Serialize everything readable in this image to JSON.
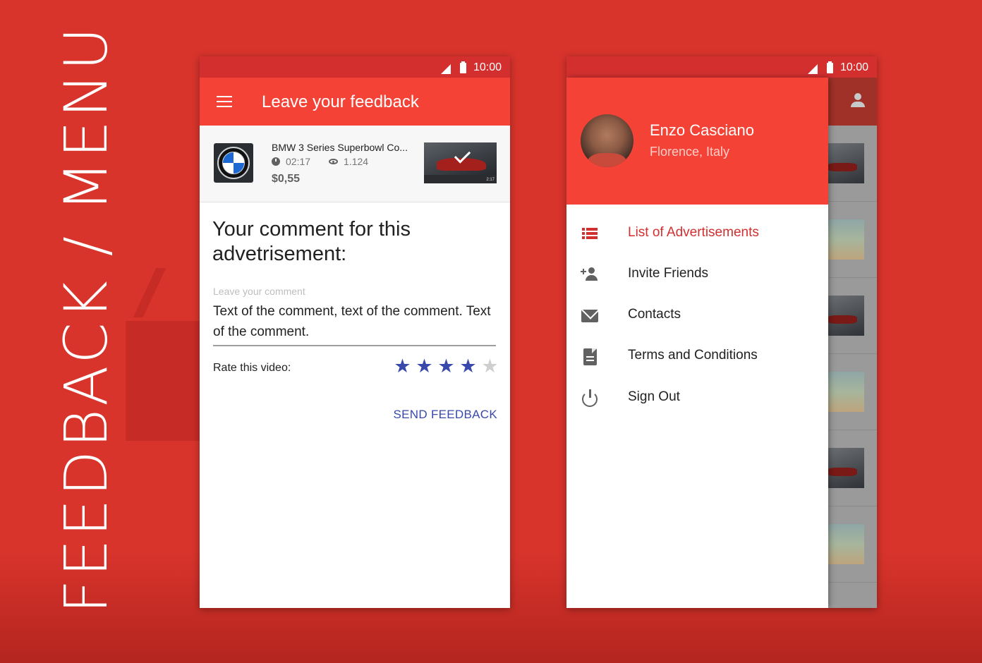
{
  "side_title": "FEEDBACK / MENU",
  "status_bar": {
    "time": "10:00"
  },
  "feedback_screen": {
    "app_bar": {
      "title": "Leave your feedback",
      "menu_icon": "hamburger-menu-icon"
    },
    "video": {
      "title": "BMW 3 Series Superbowl Co...",
      "duration": "02:17",
      "views": "1.124",
      "price": "$0,55",
      "thumb_duration": "2:17",
      "brand_logo": "bmw-logo",
      "watched_icon": "checkmark-icon"
    },
    "heading": "Your comment for this advetrisement:",
    "comment_placeholder": "Leave your comment",
    "comment_text": "Text of the comment, text of the comment. Text of the comment.",
    "rate_label": "Rate this video:",
    "rating": {
      "value": 4,
      "max": 5
    },
    "send_button": "SEND FEEDBACK",
    "colors": {
      "primary": "#f44336",
      "accent": "#3949ab"
    }
  },
  "menu_screen": {
    "user": {
      "name": "Enzo Casciano",
      "location": "Florence, Italy"
    },
    "nav_items": [
      {
        "label": "List of Advertisements",
        "icon": "list-icon",
        "active": true
      },
      {
        "label": "Invite Friends",
        "icon": "add-person-icon",
        "active": false
      },
      {
        "label": "Contacts",
        "icon": "mail-icon",
        "active": false
      },
      {
        "label": "Terms and Conditions",
        "icon": "document-icon",
        "active": false
      },
      {
        "label": "Sign Out",
        "icon": "power-icon",
        "active": false
      }
    ],
    "background_icon": "account-icon",
    "colors": {
      "active": "#d32f2f",
      "header": "#f44336"
    }
  }
}
